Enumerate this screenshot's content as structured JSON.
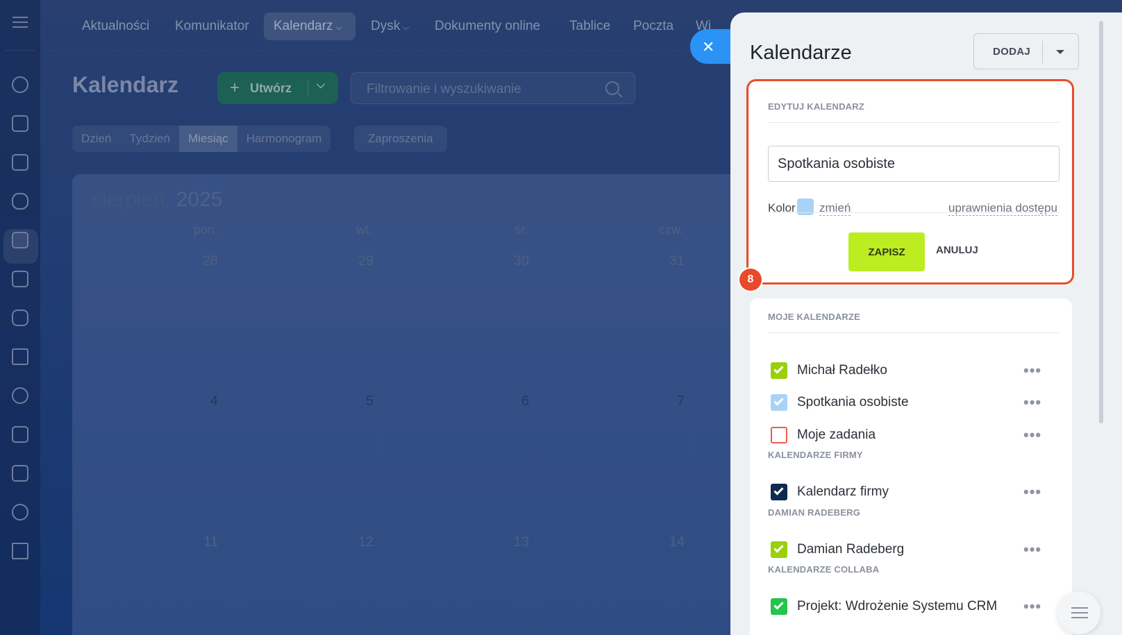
{
  "topnav": {
    "items": [
      "Aktualności",
      "Komunikator",
      "Kalendarz",
      "Dysk",
      "Dokumenty online",
      "Tablice",
      "Poczta",
      "Wi"
    ]
  },
  "page": {
    "title": "Kalendarz",
    "create_label": "Utwórz",
    "search_placeholder": "Filtrowanie i wyszukiwanie",
    "views": [
      "Dzień",
      "Tydzień",
      "Miesiąc",
      "Harmonogram"
    ],
    "invites_label": "Zaproszenia"
  },
  "calendar": {
    "month": "sierpień,",
    "year": "2025",
    "weekdays": [
      "pon.",
      "wt.",
      "śr.",
      "czw."
    ],
    "week1": [
      "28",
      "29",
      "30",
      "31"
    ],
    "week2": [
      "4",
      "5",
      "6",
      "7"
    ],
    "week3": [
      "11",
      "12",
      "13",
      "14"
    ]
  },
  "panel": {
    "title": "Kalendarze",
    "add_label": "DODAJ",
    "edit_section": "EDYTUJ KALENDARZ",
    "name_value": "Spotkania osobiste",
    "color_label": "Kolor",
    "color_hex": "#a8d3f7",
    "change_label": "zmień",
    "permissions_label": "uprawnienia dostępu",
    "save_label": "ZAPISZ",
    "cancel_label": "ANULUJ",
    "step_badge": "8",
    "my_section": "MOJE KALENDARZE",
    "company_section": "KALENDARZE FIRMY",
    "damian_section": "DAMIAN RADEBERG",
    "collab_section": "KALENDARZE COLLABA",
    "calendars": {
      "c1": {
        "name": "Michał Radełko",
        "color": "#9bcf0c",
        "checked": true
      },
      "c2": {
        "name": "Spotkania osobiste",
        "color": "#a8d3f7",
        "checked": true
      },
      "c3": {
        "name": "Moje zadania",
        "color": "#f05a4f",
        "checked": false
      },
      "c4": {
        "name": "Kalendarz firmy",
        "color": "#0d2a4f",
        "checked": true
      },
      "c5": {
        "name": "Damian Radeberg",
        "color": "#9bcf0c",
        "checked": true
      },
      "c6": {
        "name": "Projekt: Wdrożenie Systemu CRM",
        "color": "#23c54a",
        "checked": true
      }
    }
  },
  "accent": {
    "highlight_outline": "#e84d2a",
    "close_button": "#2a93f5",
    "save_button": "#bbed21"
  }
}
